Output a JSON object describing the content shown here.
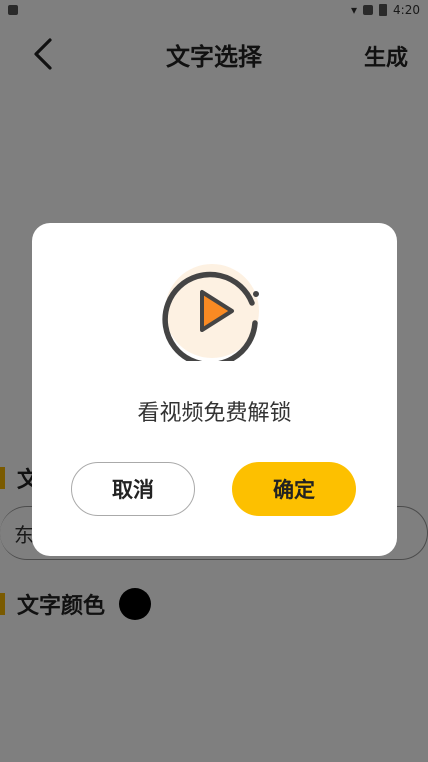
{
  "status_bar": {
    "time": "4:20"
  },
  "nav": {
    "title": "文字选择",
    "generate": "生成"
  },
  "sections": {
    "text": {
      "label": "文"
    },
    "input": {
      "value": "东"
    },
    "color": {
      "label": "文字颜色",
      "swatch": "#000000"
    }
  },
  "dialog": {
    "message": "看视频免费解锁",
    "cancel": "取消",
    "confirm": "确定",
    "icon": "play-icon",
    "accent": "#fdc000"
  }
}
